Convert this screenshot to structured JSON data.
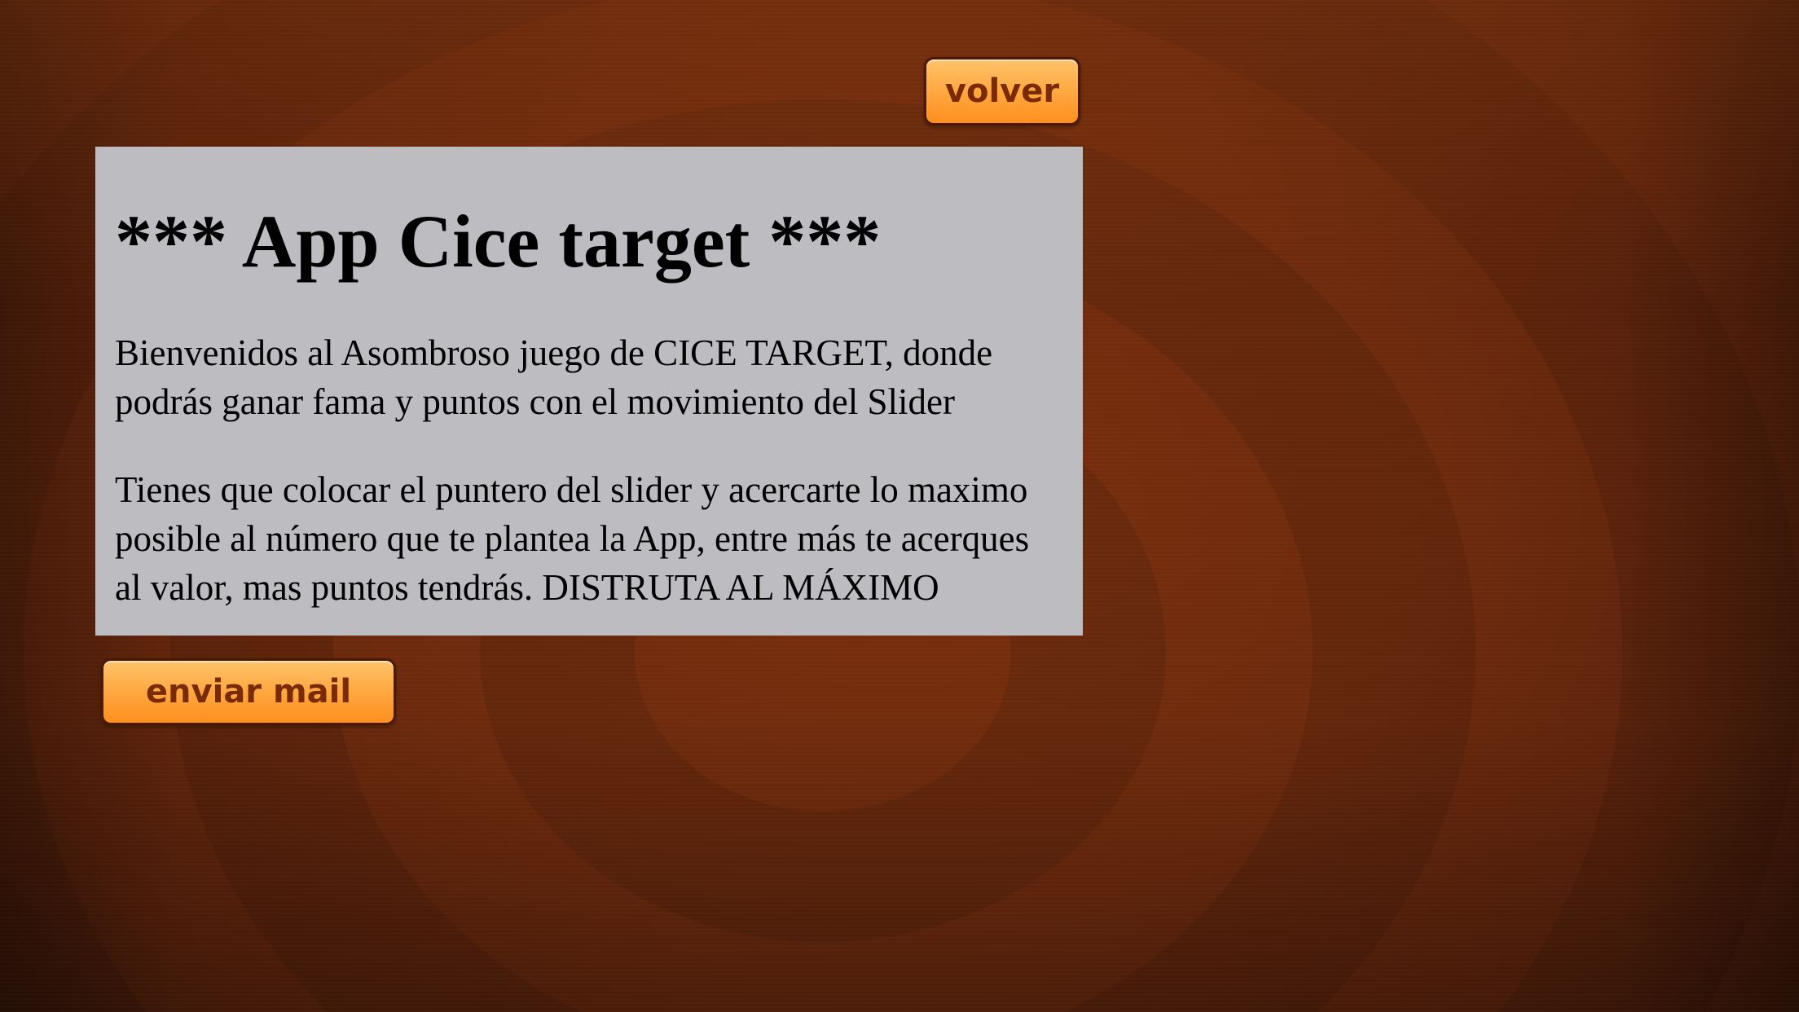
{
  "screen": {
    "back_button_label": "volver",
    "send_mail_button_label": "enviar mail"
  },
  "content": {
    "title": "*** App Cice target ***",
    "paragraph_1": "Bienvenidos al Asombroso juego de CICE TARGET, donde podrás ganar fama y puntos con el movimiento del Slider",
    "paragraph_2": "Tienes que colocar el puntero del slider y acercarte lo maximo posible al número que te plantea la App, entre más te acerques al valor, mas puntos tendrás. DISTRUTA AL MÁXIMO"
  },
  "colors": {
    "button_top": "#ffc36a",
    "button_bottom": "#ff8f1f",
    "button_text": "#7a2a05",
    "webview_background": "#bcbcc1",
    "background": "#6a280c"
  }
}
